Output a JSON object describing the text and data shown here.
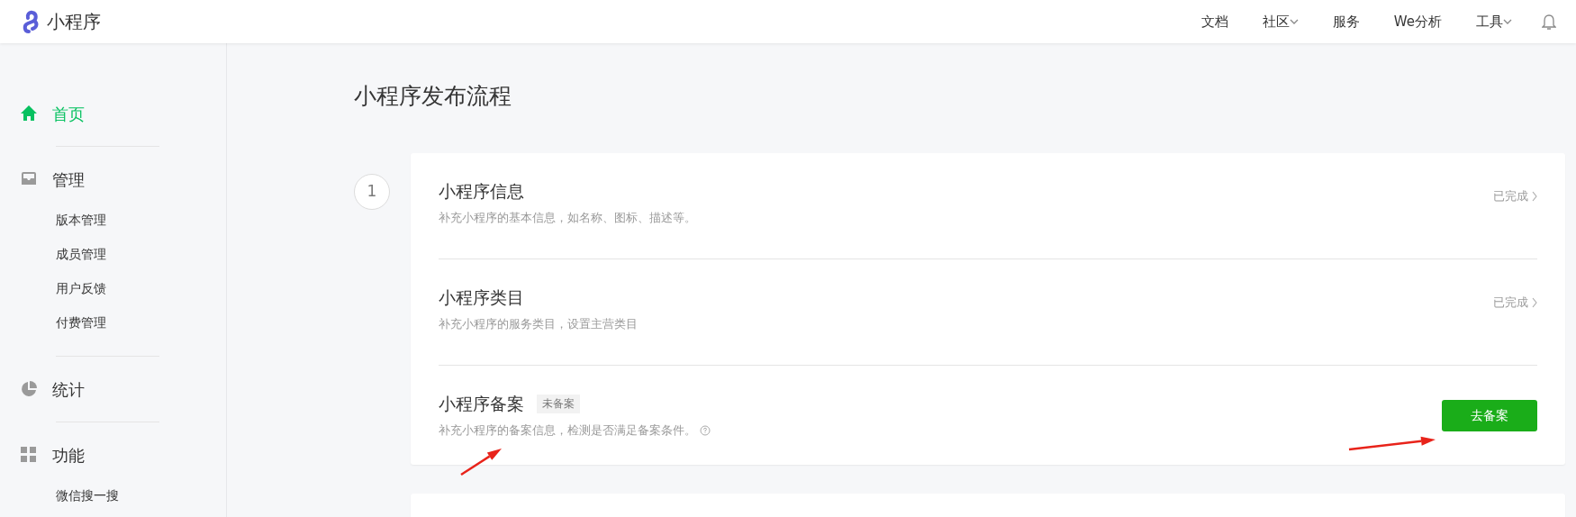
{
  "header": {
    "logo_text": "小程序",
    "nav": [
      {
        "label": "文档",
        "dropdown": false
      },
      {
        "label": "社区",
        "dropdown": true
      },
      {
        "label": "服务",
        "dropdown": false
      },
      {
        "label": "We分析",
        "dropdown": false
      },
      {
        "label": "工具",
        "dropdown": true
      }
    ]
  },
  "sidebar": {
    "items": [
      {
        "kind": "home",
        "label": "首页",
        "selected": true
      },
      {
        "kind": "manage",
        "label": "管理",
        "selected": false,
        "children": [
          {
            "label": "版本管理",
            "selected": false
          },
          {
            "label": "成员管理",
            "selected": false
          },
          {
            "label": "用户反馈",
            "selected": false
          },
          {
            "label": "付费管理",
            "selected": false
          }
        ]
      },
      {
        "kind": "stats",
        "label": "统计",
        "selected": false
      },
      {
        "kind": "features",
        "label": "功能",
        "selected": false,
        "children": [
          {
            "label": "微信搜一搜",
            "selected": false
          }
        ]
      }
    ]
  },
  "page_title": "小程序发布流程",
  "steps": [
    {
      "kind": "full",
      "number": "1",
      "rows": [
        {
          "title": "小程序信息",
          "description": "补充小程序的基本信息，如名称、图标、描述等。",
          "action": {
            "kind": "status",
            "text": "已完成"
          }
        },
        {
          "title": "小程序类目",
          "description": "补充小程序的服务类目，设置主营类目",
          "action": {
            "kind": "status",
            "text": "已完成"
          }
        },
        {
          "title": "小程序备案",
          "badge": "未备案",
          "description": "补充小程序的备案信息，检测是否满足备案条件。",
          "help": true,
          "action": {
            "kind": "button",
            "text": "去备案"
          }
        }
      ]
    },
    {
      "kind": "cut_off"
    }
  ]
}
